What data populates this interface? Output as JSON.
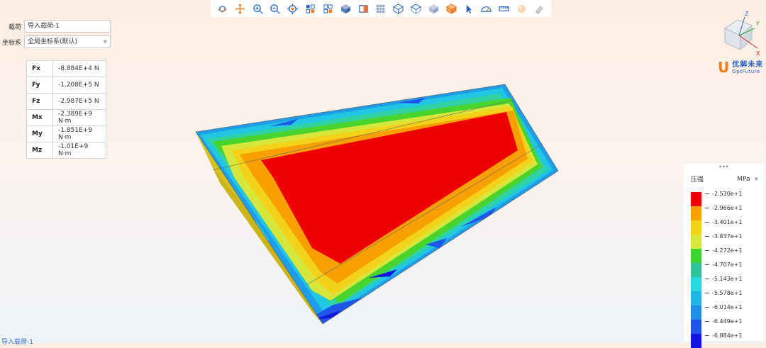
{
  "toolbar": {
    "buttons": [
      "rotate-icon",
      "pan-icon",
      "zoom-in-icon",
      "zoom-out-icon",
      "fit-view-icon",
      "box-select-icon",
      "box-deselect-icon",
      "view-cube-icon",
      "section-view-icon",
      "mesh-view-icon",
      "wireframe-icon",
      "hidden-line-icon",
      "shaded-icon",
      "shaded-edges-icon",
      "select-pointer-icon",
      "protractor-icon",
      "ruler-icon",
      "sphere-icon",
      "eraser-icon"
    ]
  },
  "panel": {
    "load_label": "载荷",
    "load_value": "导入载荷-1",
    "coord_label": "坐标系",
    "coord_value": "全局坐标系(默认)"
  },
  "load_table": [
    {
      "key": "Fx",
      "value": "-8.884E+4 N"
    },
    {
      "key": "Fy",
      "value": "-1.208E+5 N"
    },
    {
      "key": "Fz",
      "value": "-2.987E+5 N"
    },
    {
      "key": "Mx",
      "value": "-2.389E+9 N·m"
    },
    {
      "key": "My",
      "value": "-1.851E+9 N·m"
    },
    {
      "key": "Mz",
      "value": "-1.01E+9 N·m"
    }
  ],
  "footer": {
    "label": "导入载荷-1"
  },
  "axes": {
    "z": "Z",
    "y": "Y",
    "x": "X"
  },
  "logo": {
    "mark": "U",
    "cn": "优解未来",
    "en": "OptFuture"
  },
  "legend": {
    "handle": "•••",
    "title": "压强",
    "unit": "MPa",
    "colors": [
      "#ee0000",
      "#f7a000",
      "#f5d21a",
      "#d8e83a",
      "#3ed42e",
      "#2ec49a",
      "#29d8e0",
      "#20b6e6",
      "#1f8fe8",
      "#1f55e8",
      "#1515e0"
    ],
    "ticks": [
      "-2.530e+1",
      "-2.966e+1",
      "-3.401e+1",
      "-3.837e+1",
      "-4.272e+1",
      "-4.707e+1",
      "-5.143e+1",
      "-5.578e+1",
      "-6.014e+1",
      "-6.449e+1",
      "-6.884e+1"
    ]
  }
}
